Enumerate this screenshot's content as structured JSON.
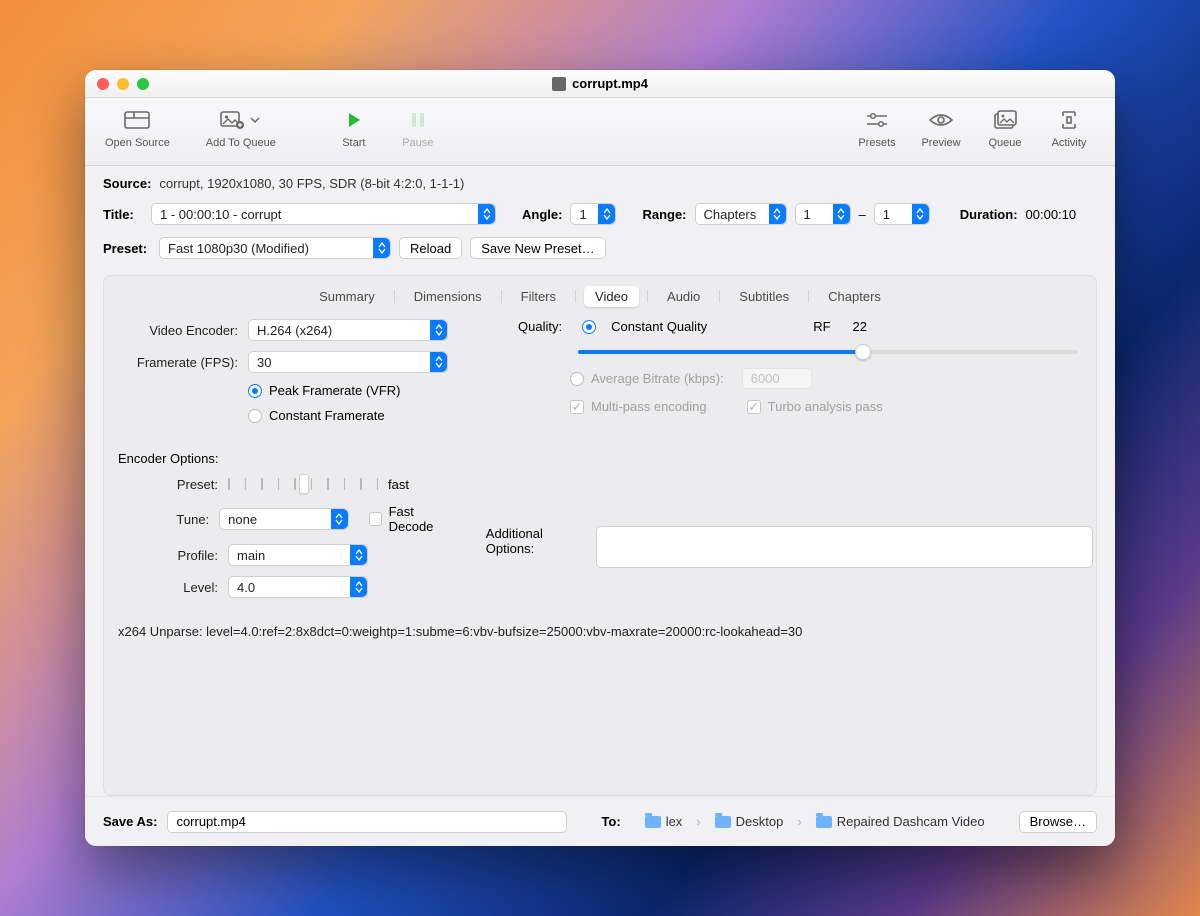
{
  "window": {
    "title": "corrupt.mp4"
  },
  "toolbar": {
    "open_source": "Open Source",
    "add_to_queue": "Add To Queue",
    "start": "Start",
    "pause": "Pause",
    "presets": "Presets",
    "preview": "Preview",
    "queue": "Queue",
    "activity": "Activity"
  },
  "source": {
    "label": "Source:",
    "value": "corrupt, 1920x1080, 30 FPS, SDR (8-bit 4:2:0, 1-1-1)"
  },
  "title_row": {
    "label": "Title:",
    "value": "1 - 00:00:10 - corrupt",
    "angle_label": "Angle:",
    "angle": "1",
    "range_label": "Range:",
    "range_mode": "Chapters",
    "range_from": "1",
    "range_to": "1",
    "dash": "–",
    "duration_label": "Duration:",
    "duration": "00:00:10"
  },
  "preset_row": {
    "label": "Preset:",
    "value": "Fast 1080p30 (Modified)",
    "reload": "Reload",
    "save_new": "Save New Preset…"
  },
  "tabs": [
    "Summary",
    "Dimensions",
    "Filters",
    "Video",
    "Audio",
    "Subtitles",
    "Chapters"
  ],
  "video": {
    "encoder_label": "Video Encoder:",
    "encoder": "H.264 (x264)",
    "framerate_label": "Framerate (FPS):",
    "framerate": "30",
    "peak_vfr": "Peak Framerate (VFR)",
    "constant_fr": "Constant Framerate",
    "quality_label": "Quality:",
    "cq_label": "Constant Quality",
    "rf_label": "RF",
    "rf_value": "22",
    "abr_label": "Average Bitrate (kbps):",
    "abr_value": "6000",
    "multipass": "Multi-pass encoding",
    "turbo": "Turbo analysis pass",
    "encoder_options_label": "Encoder Options:",
    "preset_label": "Preset:",
    "preset_value": "fast",
    "tune_label": "Tune:",
    "tune": "none",
    "fast_decode": "Fast Decode",
    "profile_label": "Profile:",
    "profile": "main",
    "addl_label": "Additional Options:",
    "level_label": "Level:",
    "level": "4.0",
    "unparse": "x264 Unparse: level=4.0:ref=2:8x8dct=0:weightp=1:subme=6:vbv-bufsize=25000:vbv-maxrate=20000:rc-lookahead=30"
  },
  "footer": {
    "saveas_label": "Save As:",
    "saveas_value": "corrupt.mp4",
    "to_label": "To:",
    "path": [
      "lex",
      "Desktop",
      "Repaired Dashcam Video"
    ],
    "browse": "Browse…"
  }
}
